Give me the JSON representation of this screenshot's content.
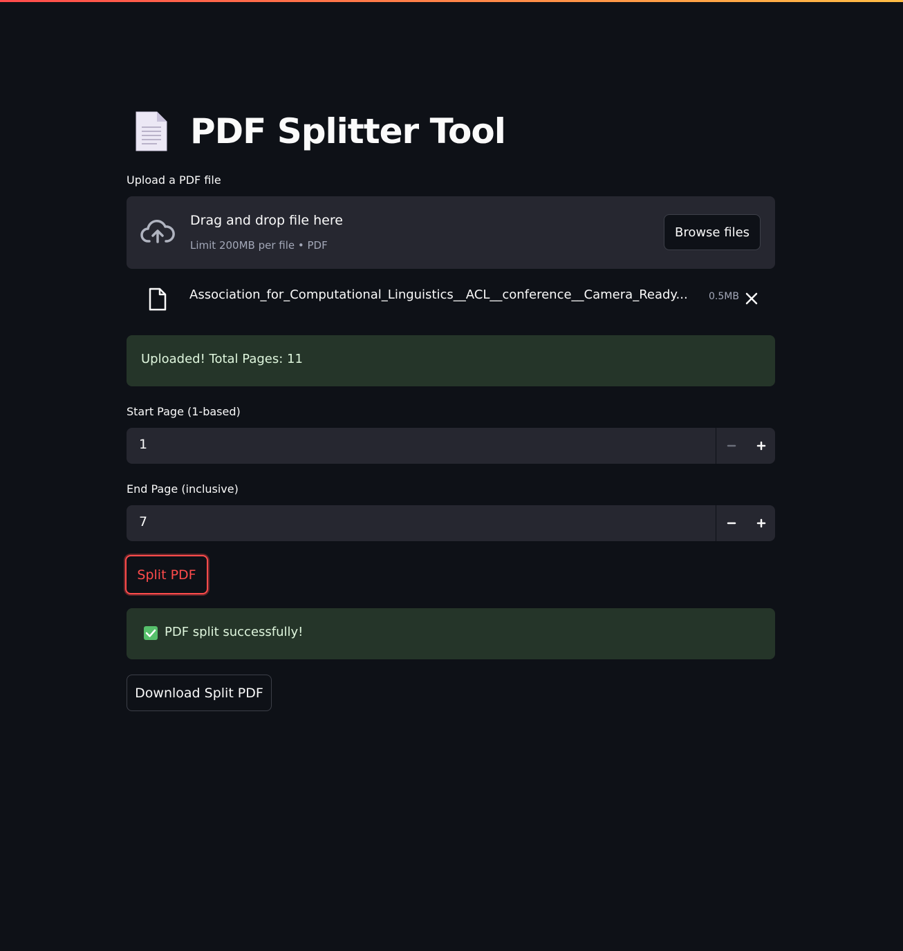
{
  "app": {
    "title": "PDF Splitter Tool",
    "title_icon": "document-icon",
    "accent_gradient": [
      "#ff4b4b",
      "#ffbd45"
    ]
  },
  "uploader": {
    "label": "Upload a PDF file",
    "drop_title": "Drag and drop file here",
    "drop_subtitle": "Limit 200MB per file • PDF",
    "browse_label": "Browse files",
    "file": {
      "name": "Association_for_Computational_Linguistics__ACL__conference__Camera_Ready...",
      "size": "0.5MB"
    }
  },
  "upload_status": {
    "message": "Uploaded! Total Pages: 11"
  },
  "start_page": {
    "label": "Start Page (1-based)",
    "value": "1"
  },
  "end_page": {
    "label": "End Page (inclusive)",
    "value": "7"
  },
  "split_button": {
    "label": "Split PDF",
    "color": "#ff4b4b"
  },
  "split_status": {
    "icon": "check-mark-icon",
    "message": "PDF split successfully!"
  },
  "download_button": {
    "label": "Download Split PDF"
  }
}
